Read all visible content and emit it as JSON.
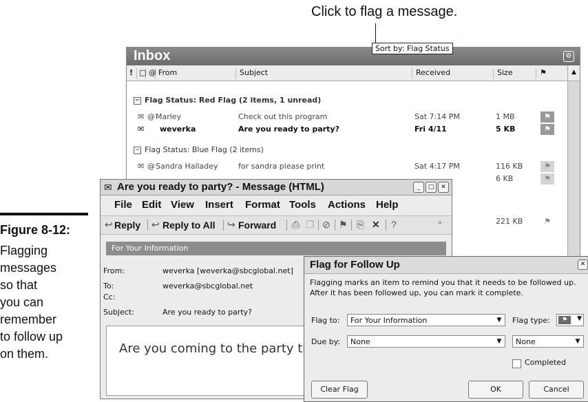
{
  "callout": "Click to flag a message.",
  "figure": {
    "number": "Figure 8-12:",
    "caption": "Flagging\nmessages\nso that\nyou can\nremember\nto follow up\non them."
  },
  "inbox": {
    "title": "Inbox",
    "columns": {
      "from": "From",
      "subject": "Subject",
      "received": "Received",
      "size": "Size"
    },
    "groups": [
      {
        "label": "Flag Status: Red Flag",
        "count": "(2 items, 1 unread)"
      },
      {
        "label": "Flag Status: Blue Flag",
        "count": "(2 items)"
      }
    ],
    "rows": [
      {
        "from": "Marley",
        "subject": "Check out this program",
        "received": "Sat 7:14 PM",
        "size": "1 MB"
      },
      {
        "from": "weverka",
        "subject": "Are you ready to party?",
        "received": "Fri 4/11",
        "size": "5 KB"
      },
      {
        "from": "Sandra Halladey",
        "subject": "for sandra please print",
        "received": "Sat 4:17 PM",
        "size": "116 KB"
      },
      {
        "size": "6 KB"
      },
      {
        "size": "221 KB"
      }
    ],
    "tooltip": "Sort by: Flag Status"
  },
  "message": {
    "title": "Are you ready to party? - Message (HTML)",
    "menu": [
      "File",
      "Edit",
      "View",
      "Insert",
      "Format",
      "Tools",
      "Actions",
      "Help"
    ],
    "toolbar": {
      "reply": "Reply",
      "reply_all": "Reply to All",
      "forward": "Forward"
    },
    "info_bar": "For Your Information",
    "headers": {
      "from_label": "From:",
      "from": "weverka [weverka@sbcglobal.net]",
      "to_label": "To:",
      "to": "weverka@sbcglobal.net",
      "cc_label": "Cc:",
      "subject_label": "Subject:",
      "subject": "Are you ready to party?"
    },
    "body": "Are you coming to the party this afternoon?"
  },
  "dialog": {
    "title": "Flag for Follow Up",
    "description": "Flagging marks an item to remind you that it needs to be followed up.  After it has been followed up, you can mark it complete.",
    "flag_to_label": "Flag to:",
    "flag_to_value": "For Your Information",
    "flag_type_label": "Flag type:",
    "due_by_label": "Due by:",
    "due_by_value": "None",
    "time_value": "None",
    "completed_label": "Completed",
    "completed_checked": false,
    "clear_flag": "Clear Flag",
    "ok": "OK",
    "cancel": "Cancel"
  }
}
